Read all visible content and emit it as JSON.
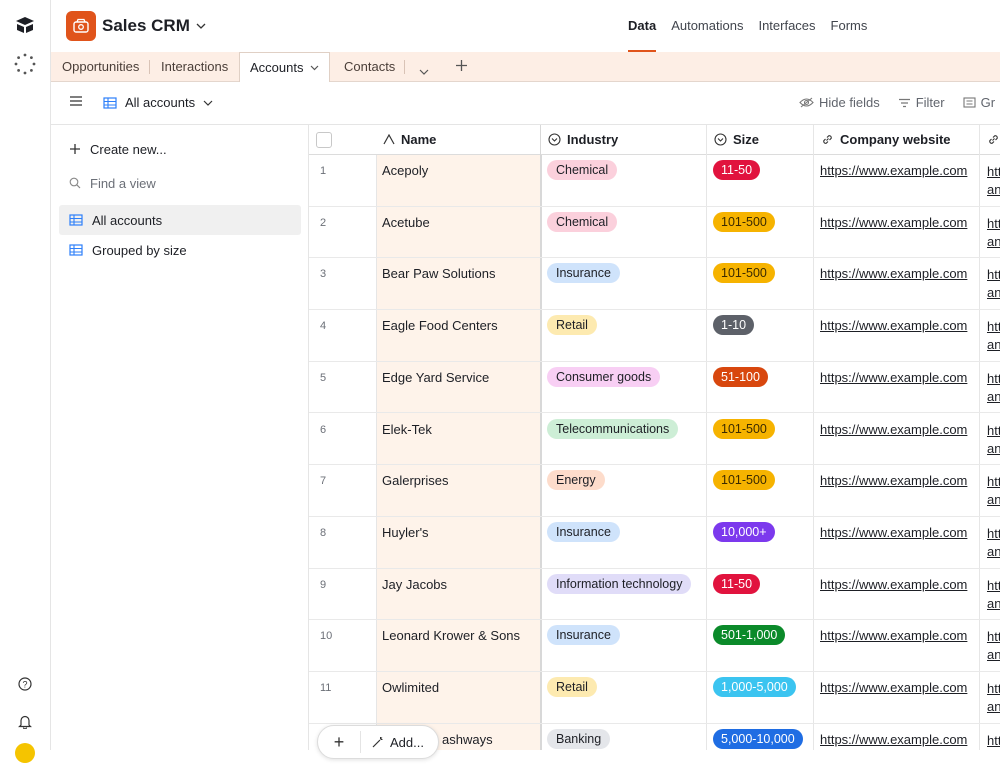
{
  "app": {
    "base_title": "Sales CRM",
    "top_tabs": [
      "Data",
      "Automations",
      "Interfaces",
      "Forms"
    ],
    "active_top_tab": "Data"
  },
  "table_tabs": {
    "items": [
      "Opportunities",
      "Interactions",
      "Accounts",
      "Contacts"
    ],
    "active": "Accounts"
  },
  "view": {
    "name": "All accounts",
    "tools": [
      "Hide fields",
      "Filter",
      "Gr"
    ]
  },
  "sidebar": {
    "create": "Create new...",
    "find": "Find a view",
    "views": [
      "All accounts",
      "Grouped by size"
    ]
  },
  "grid": {
    "headers": [
      "Name",
      "Industry",
      "Size",
      "Company website"
    ],
    "rows": [
      {
        "num": "1",
        "name": "Acepoly",
        "industry": "Chemical",
        "size": "11-50",
        "website": "https://www.example.com",
        "cut1": "htt",
        "cut2": "an"
      },
      {
        "num": "2",
        "name": "Acetube",
        "industry": "Chemical",
        "size": "101-500",
        "website": "https://www.example.com",
        "cut1": "htt",
        "cut2": "an"
      },
      {
        "num": "3",
        "name": "Bear Paw Solutions",
        "industry": "Insurance",
        "size": "101-500",
        "website": "https://www.example.com",
        "cut1": "htt",
        "cut2": "an"
      },
      {
        "num": "4",
        "name": "Eagle Food Centers",
        "industry": "Retail",
        "size": "1-10",
        "website": "https://www.example.com",
        "cut1": "htt",
        "cut2": "an"
      },
      {
        "num": "5",
        "name": "Edge Yard Service",
        "industry": "Consumer goods",
        "size": "51-100",
        "website": "https://www.example.com",
        "cut1": "htt",
        "cut2": "an"
      },
      {
        "num": "6",
        "name": "Elek-Tek",
        "industry": "Telecommunications",
        "size": "101-500",
        "website": "https://www.example.com",
        "cut1": "htt",
        "cut2": "an"
      },
      {
        "num": "7",
        "name": "Galerprises",
        "industry": "Energy",
        "size": "101-500",
        "website": "https://www.example.com",
        "cut1": "htt",
        "cut2": "an"
      },
      {
        "num": "8",
        "name": "Huyler's",
        "industry": "Insurance",
        "size": "10,000+",
        "website": "https://www.example.com",
        "cut1": "htt",
        "cut2": "an"
      },
      {
        "num": "9",
        "name": "Jay Jacobs",
        "industry": "Information technology",
        "size": "11-50",
        "website": "https://www.example.com",
        "cut1": "htt",
        "cut2": "an"
      },
      {
        "num": "10",
        "name": "Leonard Krower & Sons",
        "industry": "Insurance",
        "size": "501-1,000",
        "website": "https://www.example.com",
        "cut1": "htt",
        "cut2": "an"
      },
      {
        "num": "11",
        "name": "Owlimited",
        "industry": "Retail",
        "size": "1,000-5,000",
        "website": "https://www.example.com",
        "cut1": "htt",
        "cut2": "an"
      },
      {
        "num": "",
        "name": "ashways",
        "industry": "Banking",
        "size": "5,000-10,000",
        "website": "https://www.example.com",
        "cut1": "htt",
        "cut2": ""
      }
    ]
  },
  "industry_colors": {
    "Chemical": "#fbd0dc",
    "Insurance": "#cfe3fb",
    "Retail": "#fdeab0",
    "Consumer goods": "#f8cff4",
    "Telecommunications": "#cdeed6",
    "Energy": "#fddccb",
    "Information technology": "#e0dcf8",
    "Banking": "#e4e6ea"
  },
  "size_colors": {
    "11-50": "#e1133e",
    "101-500": "#f6b300",
    "1-10": "#5d6169",
    "51-100": "#d8470e",
    "10,000+": "#7c39ed",
    "501-1,000": "#0b8a2a",
    "1,000-5,000": "#3bc4f0",
    "5,000-10,000": "#1f6de3"
  },
  "add_bar": {
    "add_label": "Add..."
  }
}
